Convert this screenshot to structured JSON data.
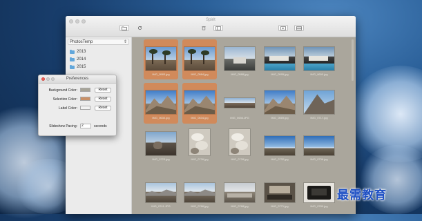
{
  "window": {
    "title": "Spirit",
    "toolbar_icons": [
      "folder-icon",
      "refresh-icon",
      "trash-icon",
      "window-icon",
      "play-icon",
      "grid-icon"
    ]
  },
  "sidebar": {
    "source": "PhotosTemp",
    "folders": [
      "2013",
      "2014",
      "2015"
    ]
  },
  "photos": [
    {
      "name": "IMG_0583.jpg",
      "selected": true,
      "scene": "palms-sky"
    },
    {
      "name": "IMG_0584.jpg",
      "selected": true,
      "scene": "palms-sky"
    },
    {
      "name": "IMG_0588.jpg",
      "selected": false,
      "scene": "mountain-house"
    },
    {
      "name": "IMG_0595.jpg",
      "selected": false,
      "scene": "pool-house"
    },
    {
      "name": "IMG_0600.jpg",
      "selected": false,
      "scene": "pool-house"
    },
    {
      "name": "IMG_0630.jpg",
      "selected": true,
      "scene": "desert-mountain"
    },
    {
      "name": "IMG_0634.jpg",
      "selected": true,
      "scene": "desert-mountain"
    },
    {
      "name": "IMG_0636.JPG",
      "selected": false,
      "scene": "wide-landscape"
    },
    {
      "name": "IMG_0669.jpg",
      "selected": false,
      "scene": "desert-mountain"
    },
    {
      "name": "IMG_0717.jpg",
      "selected": false,
      "scene": "peak"
    },
    {
      "name": "IMG_0723.jpg",
      "selected": false,
      "scene": "rocks"
    },
    {
      "name": "IMG_0726.jpg",
      "selected": false,
      "scene": "boulders"
    },
    {
      "name": "IMG_0728.jpg",
      "selected": false,
      "scene": "boulders"
    },
    {
      "name": "IMG_0732.jpg",
      "selected": false,
      "scene": "sky-horizon"
    },
    {
      "name": "IMG_0736.jpg",
      "selected": false,
      "scene": "sky-horizon"
    },
    {
      "name": "IMG_0741.JPG",
      "selected": false,
      "scene": "valley"
    },
    {
      "name": "IMG_0766.jpg",
      "selected": false,
      "scene": "valley"
    },
    {
      "name": "IMG_0768.jpg",
      "selected": false,
      "scene": "valley-gray"
    },
    {
      "name": "IMG_0771.jpg",
      "selected": false,
      "scene": "dark-room"
    },
    {
      "name": "IMG_0780.jpg",
      "selected": false,
      "scene": "dark-device"
    }
  ],
  "preferences": {
    "title": "Preferences",
    "background_label": "Background Color:",
    "selection_label": "Selection Color:",
    "label_label": "Label Color:",
    "reset": "Reset",
    "slideshow_label": "Slideshow Pacing:",
    "slideshow_value": "2",
    "slideshow_unit": "seconds",
    "colors": {
      "background": "#a7a498",
      "selection": "#c99066",
      "label": "#f2f2f2"
    }
  },
  "colors": {
    "selection": "#d18a5b",
    "grid_bg": "#aaa69c"
  },
  "watermark": "最需教育"
}
